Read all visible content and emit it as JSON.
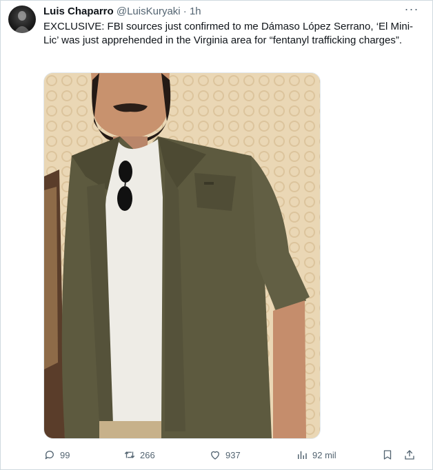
{
  "tweet": {
    "author_name": "Luis Chaparro",
    "author_handle": "@LuisKuryaki",
    "separator": "·",
    "time": "1h",
    "more_label": "···",
    "text": "EXCLUSIVE: FBI sources just confirmed to me Dámaso López Serrano, ‘El Mini-Lic’ was just apprehended in the Virginia area for “fentanyl trafficking charges”."
  },
  "actions": {
    "replies": "99",
    "retweets": "266",
    "likes": "937",
    "views": "92 mil"
  },
  "icons": {
    "reply": "reply-icon",
    "retweet": "retweet-icon",
    "like": "heart-icon",
    "views": "views-icon",
    "bookmark": "bookmark-icon",
    "share": "share-icon"
  },
  "colors": {
    "text": "#0f1419",
    "muted": "#536471",
    "border": "#cfd9de"
  }
}
